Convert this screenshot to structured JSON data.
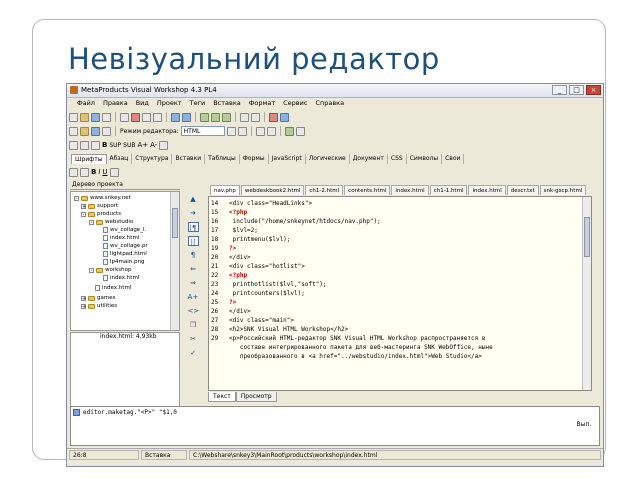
{
  "slide": {
    "title": "Невізуальний редактор"
  },
  "window": {
    "title": "MetaProducts Visual Workshop 4.3 PL4",
    "buttons": [
      "_",
      "□",
      "×"
    ]
  },
  "menu": [
    "Файл",
    "Правка",
    "Вид",
    "Проект",
    "Теги",
    "Вставка",
    "Формат",
    "Сервис",
    "Справка"
  ],
  "toolbar2": {
    "mode_label": "Режим редактора:",
    "mode_value": "HTML"
  },
  "toolbar3": {
    "sup": "SUP",
    "sub": "SUB",
    "font_bigger": "A+",
    "font_smaller": "A-"
  },
  "ribbon_tabs": [
    "Шрифты",
    "Абзац",
    "Структура",
    "Вставки",
    "Таблицы",
    "Формы",
    "JavaScript",
    "Логические",
    "Документ",
    "CSS",
    "Символы",
    "Свои"
  ],
  "project_tree": {
    "title": "Дерево проекта",
    "items": [
      {
        "label": "www.snkey.net",
        "type": "folder",
        "depth": 0
      },
      {
        "label": "support",
        "type": "folder",
        "depth": 1
      },
      {
        "label": "products",
        "type": "folder",
        "depth": 1
      },
      {
        "label": "webstudio",
        "type": "folder",
        "depth": 2
      },
      {
        "label": "wv_collage_l.",
        "type": "file",
        "depth": 3
      },
      {
        "label": "index.html",
        "type": "file",
        "depth": 3
      },
      {
        "label": "wv_collage.pr",
        "type": "file",
        "depth": 3
      },
      {
        "label": "lightpad.html",
        "type": "file",
        "depth": 3
      },
      {
        "label": "lp4main.png",
        "type": "file",
        "depth": 3
      },
      {
        "label": "workshop",
        "type": "folder",
        "depth": 2
      },
      {
        "label": "index.html",
        "type": "file",
        "depth": 3
      },
      {
        "label": "index.html",
        "type": "file",
        "depth": 2
      },
      {
        "label": "games",
        "type": "folder",
        "depth": 1
      },
      {
        "label": "utilities",
        "type": "folder",
        "depth": 1
      }
    ],
    "preview_caption": "index.html: 4,93kb"
  },
  "document_tabs": [
    "nav.php",
    "webdeskbook2.html",
    "ch1-2.html",
    "contents.html",
    "index.html",
    "ch1-1.html",
    "index.html",
    "descr.txt",
    "snk-gscp.html"
  ],
  "code_lines": [
    {
      "n": "14",
      "text": "<div class=\"HeadLinks\">"
    },
    {
      "n": "15",
      "text": "<?php"
    },
    {
      "n": "16",
      "text": " include(\"/home/snkeynet/htdocs/nav.php\");"
    },
    {
      "n": "17",
      "text": " $lvl=2;"
    },
    {
      "n": "18",
      "text": " printmenu($lvl);"
    },
    {
      "n": "19",
      "text": "?>"
    },
    {
      "n": "20",
      "text": "</div>"
    },
    {
      "n": "21",
      "text": "<div class=\"hotlist\">"
    },
    {
      "n": "22",
      "text": "<?php"
    },
    {
      "n": "23",
      "text": " printhotlist($lvl,\"soft\");"
    },
    {
      "n": "24",
      "text": " printcounters($lvl);"
    },
    {
      "n": "25",
      "text": "?>"
    },
    {
      "n": "26",
      "text": "</div>"
    },
    {
      "n": "27",
      "text": "<div class=\"main\">"
    },
    {
      "n": "28",
      "text": "<h2>SNK Visual HTML Workshop</h2>"
    },
    {
      "n": "29",
      "text": "<p>Российский HTML-редактор SNK Visual HTML Workshop распространяется в"
    },
    {
      "n": "",
      "text": "   составе интегрированного пакета для веб-мастеринга SNK WebOffice, ныне"
    },
    {
      "n": "",
      "text": "   преобразованного в <a href=\"../webstudio/index.html\">Web Studio</a>"
    }
  ],
  "bottom_tabs": [
    "Текст",
    "Просмотр"
  ],
  "console": {
    "text": "editor.maketag.\"<P>\" \"$1,0",
    "button": "Вып."
  },
  "status": {
    "position": "26:8",
    "mode": "Вставка",
    "path": "C:\\Webshare\\snkey3\\MainRoot\\products\\workshop\\index.html"
  }
}
